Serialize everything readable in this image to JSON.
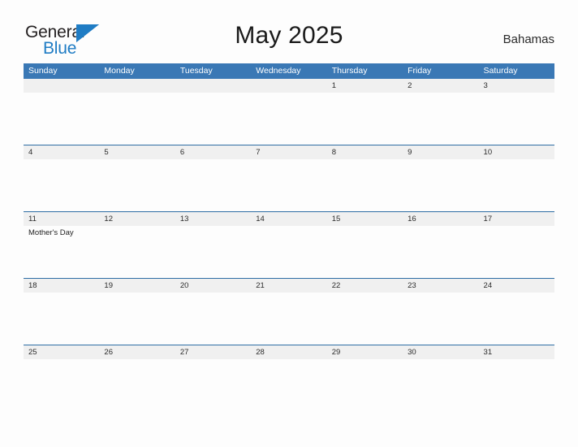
{
  "brand": {
    "name_part1": "General",
    "name_part2": "Blue",
    "flag_color": "#1f7cc4",
    "text_color": "#231f20"
  },
  "header": {
    "title": "May 2025",
    "country": "Bahamas"
  },
  "theme": {
    "header_blue": "#3a78b5",
    "rule_blue": "#2e6da4",
    "date_band": "#f0f0f0",
    "page_bg": "#fdfdfd"
  },
  "calendar": {
    "weekday_headers": [
      "Sunday",
      "Monday",
      "Tuesday",
      "Wednesday",
      "Thursday",
      "Friday",
      "Saturday"
    ],
    "weeks": [
      {
        "days": [
          {
            "date": "",
            "events": []
          },
          {
            "date": "",
            "events": []
          },
          {
            "date": "",
            "events": []
          },
          {
            "date": "",
            "events": []
          },
          {
            "date": "1",
            "events": []
          },
          {
            "date": "2",
            "events": []
          },
          {
            "date": "3",
            "events": []
          }
        ]
      },
      {
        "days": [
          {
            "date": "4",
            "events": []
          },
          {
            "date": "5",
            "events": []
          },
          {
            "date": "6",
            "events": []
          },
          {
            "date": "7",
            "events": []
          },
          {
            "date": "8",
            "events": []
          },
          {
            "date": "9",
            "events": []
          },
          {
            "date": "10",
            "events": []
          }
        ]
      },
      {
        "days": [
          {
            "date": "11",
            "events": [
              "Mother's Day"
            ]
          },
          {
            "date": "12",
            "events": []
          },
          {
            "date": "13",
            "events": []
          },
          {
            "date": "14",
            "events": []
          },
          {
            "date": "15",
            "events": []
          },
          {
            "date": "16",
            "events": []
          },
          {
            "date": "17",
            "events": []
          }
        ]
      },
      {
        "days": [
          {
            "date": "18",
            "events": []
          },
          {
            "date": "19",
            "events": []
          },
          {
            "date": "20",
            "events": []
          },
          {
            "date": "21",
            "events": []
          },
          {
            "date": "22",
            "events": []
          },
          {
            "date": "23",
            "events": []
          },
          {
            "date": "24",
            "events": []
          }
        ]
      },
      {
        "days": [
          {
            "date": "25",
            "events": []
          },
          {
            "date": "26",
            "events": []
          },
          {
            "date": "27",
            "events": []
          },
          {
            "date": "28",
            "events": []
          },
          {
            "date": "29",
            "events": []
          },
          {
            "date": "30",
            "events": []
          },
          {
            "date": "31",
            "events": []
          }
        ]
      }
    ]
  }
}
